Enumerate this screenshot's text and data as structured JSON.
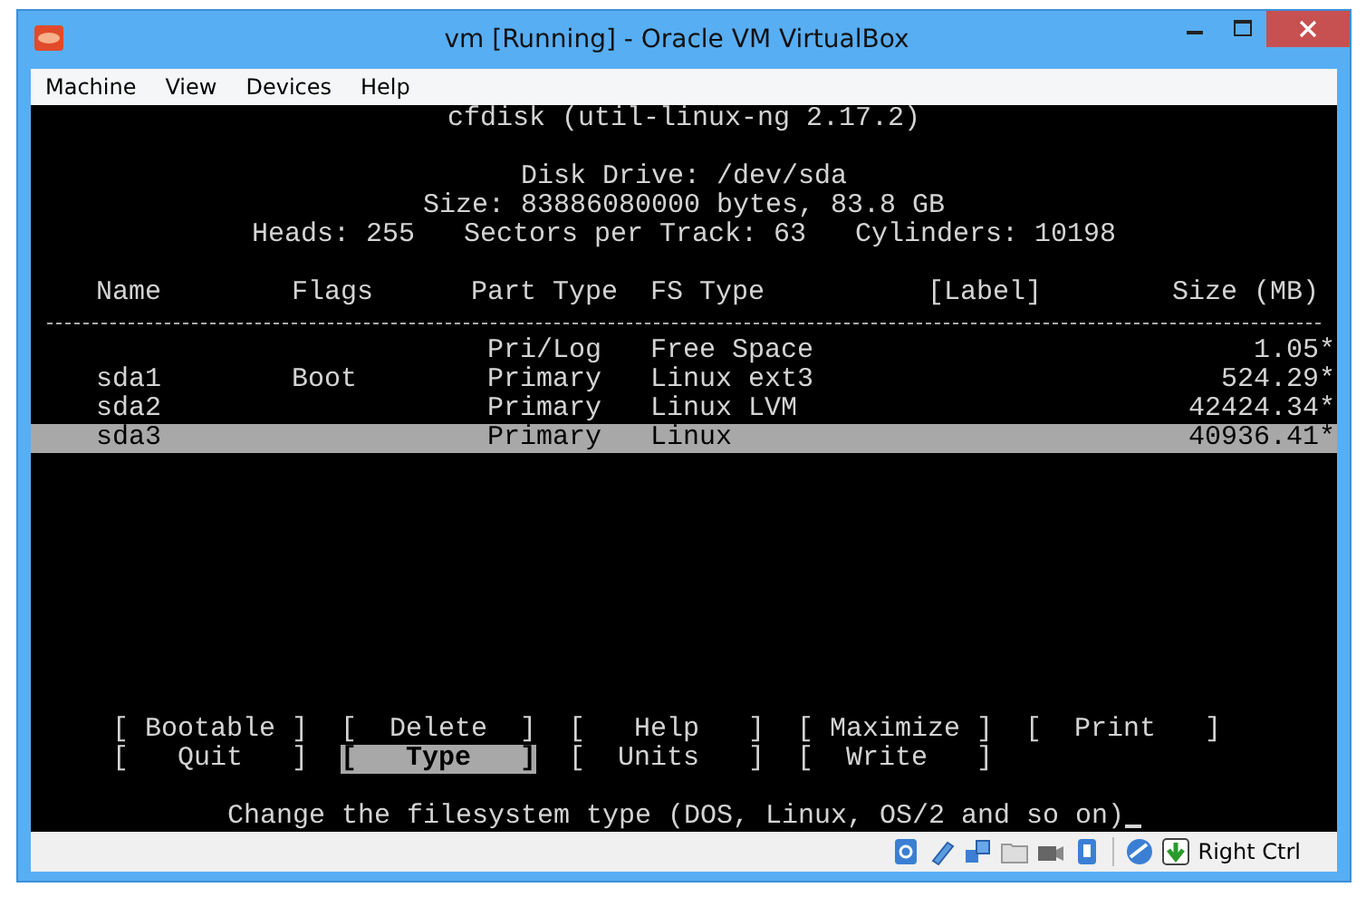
{
  "window": {
    "title": "vm [Running] - Oracle VM VirtualBox"
  },
  "menu": [
    "Machine",
    "View",
    "Devices",
    "Help"
  ],
  "terminal": {
    "heading": "cfdisk (util-linux-ng 2.17.2)",
    "disk_info": [
      "Disk Drive: /dev/sda",
      "Size: 83886080000 bytes, 83.8 GB",
      "Heads: 255   Sectors per Track: 63   Cylinders: 10198"
    ],
    "table": {
      "columns": [
        "Name",
        "Flags",
        "Part Type",
        "FS Type",
        "[Label]",
        "Size (MB)"
      ],
      "rows": [
        {
          "part_type": "Pri/Log",
          "fs_type": "Free Space",
          "size": "1.05*",
          "selected": false
        },
        {
          "name": "sda1",
          "flags": "Boot",
          "part_type": "Primary",
          "fs_type": "Linux ext3",
          "size": "524.29*",
          "selected": false
        },
        {
          "name": "sda2",
          "part_type": "Primary",
          "fs_type": "Linux LVM",
          "size": "42424.34*",
          "selected": false
        },
        {
          "name": "sda3",
          "part_type": "Primary",
          "fs_type": "Linux",
          "size": "40936.41*",
          "selected": true
        }
      ]
    },
    "commands": [
      [
        {
          "label": "[ Bootable ]",
          "selected": false
        },
        {
          "label": "[  Delete  ]",
          "selected": false
        },
        {
          "label": "[   Help   ]",
          "selected": false
        },
        {
          "label": "[ Maximize ]",
          "selected": false
        },
        {
          "label": "[  Print   ]",
          "selected": false
        }
      ],
      [
        {
          "label": "[   Quit   ]",
          "selected": false
        },
        {
          "label": "[   Type   ]",
          "selected": true
        },
        {
          "label": "[  Units   ]",
          "selected": false
        },
        {
          "label": "[  Write   ]",
          "selected": false
        }
      ]
    ],
    "message": "Change the filesystem type (DOS, Linux, OS/2 and so on)"
  },
  "status_bar": {
    "host_key": "Right Ctrl"
  }
}
